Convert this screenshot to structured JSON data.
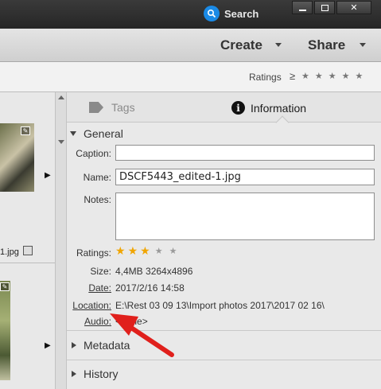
{
  "titlebar": {
    "search_label": "Search",
    "search_icon": "magnifier-icon",
    "window_buttons": [
      "minimize",
      "restore",
      "close"
    ]
  },
  "actionbar": {
    "create_label": "Create",
    "share_label": "Share"
  },
  "filterbar": {
    "ratings_label": "Ratings",
    "operator": "≥",
    "star_count": 5
  },
  "thumbnails": {
    "file_name_fragment": "1.jpg"
  },
  "tabs": {
    "tags_label": "Tags",
    "info_label": "Information",
    "active": "Information"
  },
  "general": {
    "heading": "General",
    "caption_label": "Caption:",
    "caption_value": "",
    "name_label": "Name:",
    "name_value": "DSCF5443_edited-1.jpg",
    "notes_label": "Notes:",
    "notes_value": "",
    "ratings_label": "Ratings:",
    "rating": 3,
    "rating_max": 5,
    "size_label": "Size:",
    "size_value": "4,4MB  3264x4896",
    "date_label": "Date:",
    "date_value": "2017/2/16 14:58",
    "location_label": "Location:",
    "location_value": "E:\\Rest 03 09 13\\Import photos 2017\\2017 02 16\\",
    "audio_label": "Audio:",
    "audio_value": "<none>"
  },
  "sections": {
    "metadata": "Metadata",
    "history": "History"
  },
  "colors": {
    "accent_search": "#1a8ae6",
    "star_on": "#f0a500",
    "annotation_arrow": "#e0201c"
  }
}
